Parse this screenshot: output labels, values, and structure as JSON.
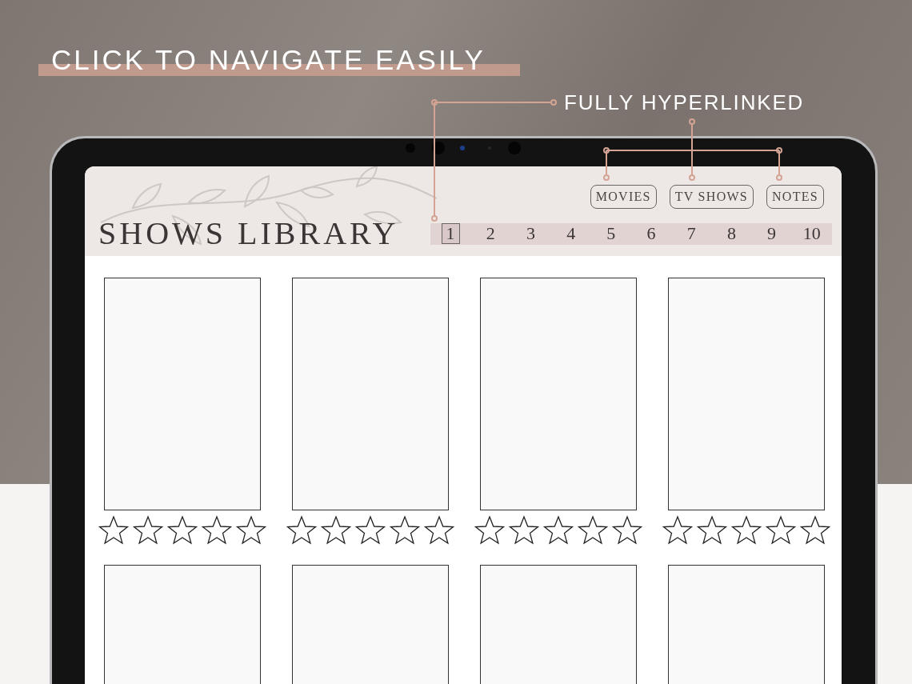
{
  "headline": "CLICK TO NAVIGATE EASILY",
  "callout": "FULLY HYPERLINKED",
  "planner": {
    "title": "SHOWS LIBRARY",
    "nav_buttons": [
      "MOVIES",
      "TV SHOWS",
      "NOTES"
    ],
    "pages": [
      {
        "label": "1",
        "selected": true
      },
      {
        "label": "2",
        "selected": false
      },
      {
        "label": "3",
        "selected": false
      },
      {
        "label": "4",
        "selected": false
      },
      {
        "label": "5",
        "selected": false
      },
      {
        "label": "6",
        "selected": false
      },
      {
        "label": "7",
        "selected": false
      },
      {
        "label": "8",
        "selected": false
      },
      {
        "label": "9",
        "selected": false
      },
      {
        "label": "10",
        "selected": false
      }
    ],
    "cards": [
      {
        "kind": "rated",
        "stars": 0
      },
      {
        "kind": "rated",
        "stars": 0
      },
      {
        "kind": "rated",
        "stars": 0
      },
      {
        "kind": "rated",
        "stars": 0
      },
      {
        "kind": "cut"
      },
      {
        "kind": "cut"
      },
      {
        "kind": "cut"
      },
      {
        "kind": "cut"
      }
    ]
  }
}
